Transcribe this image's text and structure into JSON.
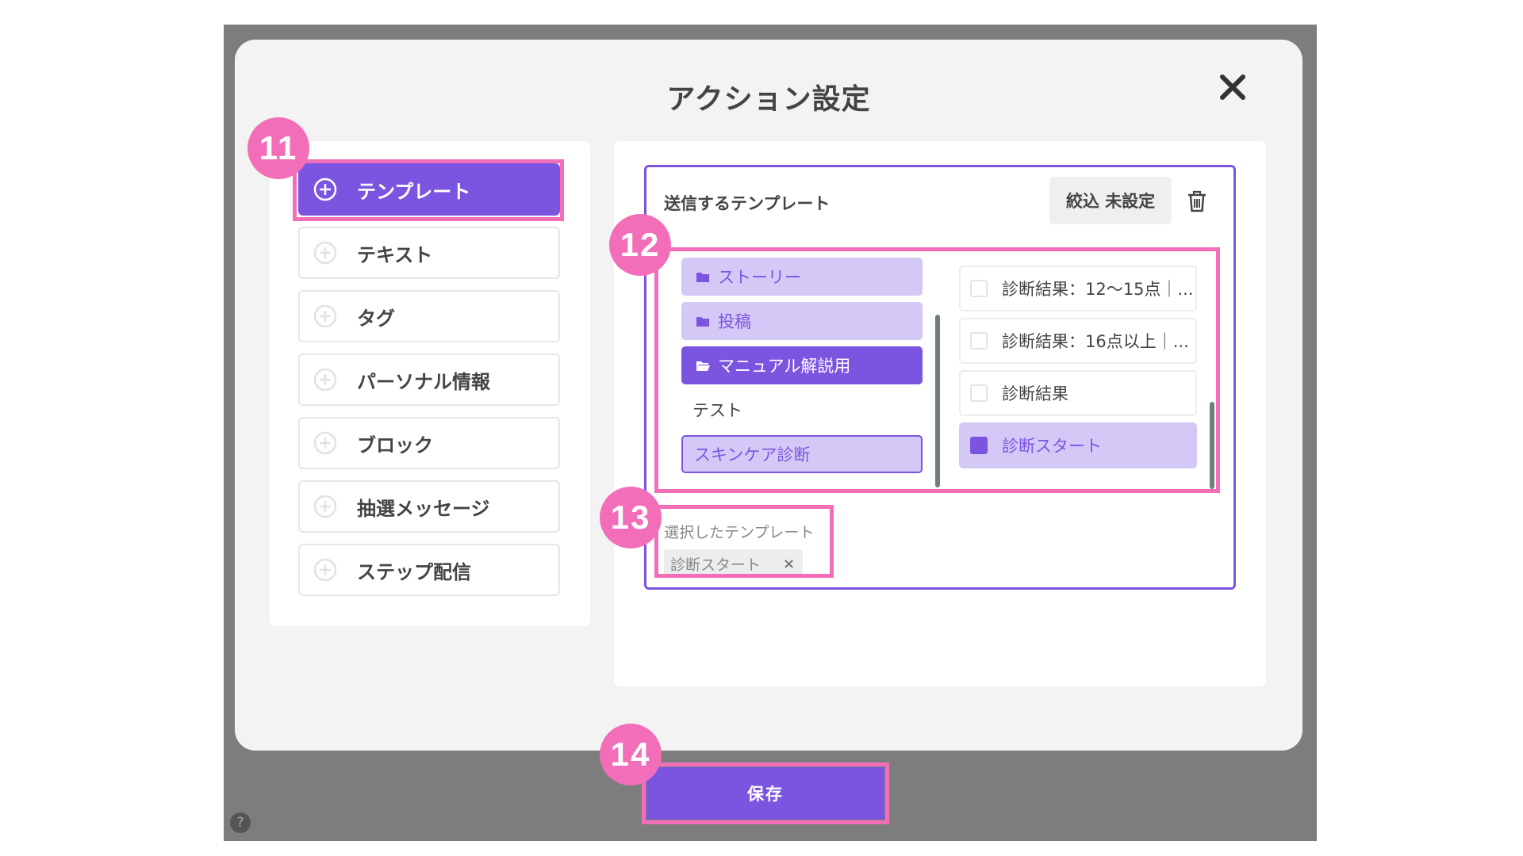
{
  "modal": {
    "title": "アクション設定"
  },
  "actions": [
    {
      "label": "テンプレート",
      "active": true
    },
    {
      "label": "テキスト"
    },
    {
      "label": "タグ"
    },
    {
      "label": "パーソナル情報"
    },
    {
      "label": "ブロック"
    },
    {
      "label": "抽選メッセージ"
    },
    {
      "label": "ステップ配信"
    }
  ],
  "template_panel": {
    "heading": "送信するテンプレート",
    "filter_label": "絞込 未設定",
    "folders": [
      {
        "label": "ストーリー",
        "icon": "folder-icon"
      },
      {
        "label": "投稿",
        "icon": "folder-icon"
      },
      {
        "label": "マニュアル解説用",
        "icon": "folder-open-icon",
        "selected": true
      },
      {
        "label": "テスト"
      },
      {
        "label": "スキンケア診断"
      }
    ],
    "templates": [
      {
        "label": "診断結果：12〜15点｜..."
      },
      {
        "label": "診断結果：16点以上｜..."
      },
      {
        "label": "診断結果"
      },
      {
        "label": "診断スタート",
        "checked": true
      }
    ],
    "selected_label": "選択したテンプレート",
    "selected_chip": "診断スタート",
    "chip_remove": "×"
  },
  "save_label": "保存",
  "annotations": [
    "11",
    "12",
    "13",
    "14"
  ],
  "colors": {
    "accent": "#7b55e0",
    "accent_light": "#d4c8f6",
    "highlight": "#f36eb8",
    "backdrop": "#7d7d7d"
  }
}
